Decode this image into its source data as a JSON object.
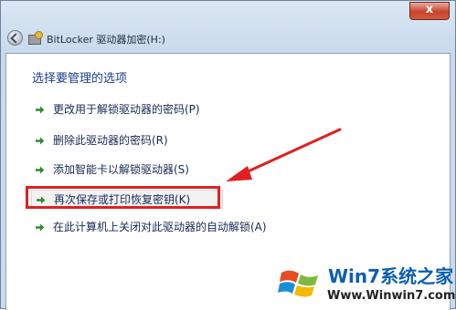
{
  "window": {
    "title": "BitLocker 驱动器加密(H:)",
    "close_label": "x"
  },
  "content": {
    "heading": "选择要管理的选项",
    "options": [
      {
        "label": "更改用于解锁驱动器的密码(P)",
        "highlighted": false
      },
      {
        "label": "删除此驱动器的密码(R)",
        "highlighted": false
      },
      {
        "label": "添加智能卡以解锁驱动器(S)",
        "highlighted": false
      },
      {
        "label": "再次保存或打印恢复密钥(K)",
        "highlighted": true
      },
      {
        "label": "在此计算机上关闭对此驱动器的自动解锁(A)",
        "highlighted": false
      }
    ]
  },
  "annotation": {
    "color": "#e02020",
    "arrow_icon": "annotation-arrow",
    "box_icon": "annotation-box"
  },
  "watermark": {
    "brand": "Win7系统之家",
    "url": "Www.Winwin7.com"
  },
  "colors": {
    "heading": "#1c3f8c",
    "option_text": "#152a55",
    "option_arrow": "#2e8b2e",
    "annotation": "#e02020"
  }
}
